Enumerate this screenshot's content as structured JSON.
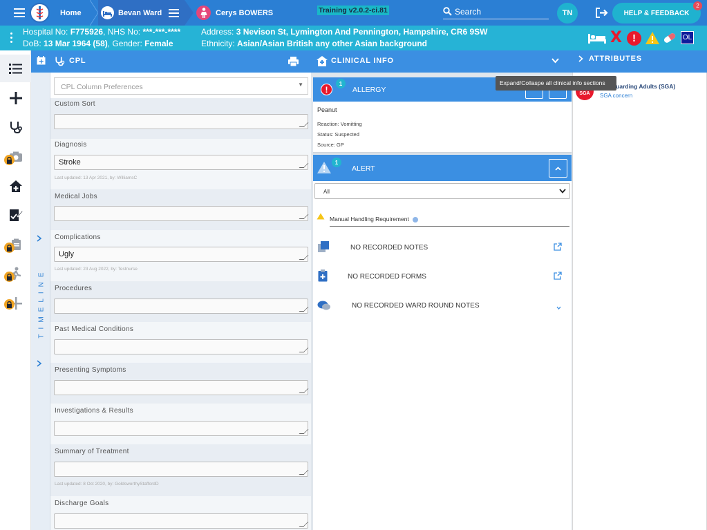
{
  "topbar": {
    "home_label": "Home",
    "ward_label": "Bevan Ward",
    "patient_label": "Cerys BOWERS",
    "training_label": "Training v2.0.2-ci.81",
    "search_label": "Search",
    "user_initials": "TN",
    "help_label": "HELP & FEEDBACK",
    "help_badge": "2"
  },
  "patient": {
    "hospital_no_label": "Hospital No:",
    "hospital_no": "F775926",
    "nhs_no_label": "NHS No:",
    "nhs_no": "***-***-****",
    "dob_label": "DoB:",
    "dob": "13 Mar 1964 (58)",
    "gender_label": "Gender:",
    "gender": "Female",
    "address_label": "Address:",
    "address": "3 Nevison St, Lymington And Pennington, Hampshire, CR6 9SW",
    "ethnicity_label": "Ethnicity:",
    "ethnicity": "Asian/Asian British any other Asian background",
    "ol_label": "OL"
  },
  "cpl": {
    "title": "CPL",
    "prefs_placeholder": "CPL Column Preferences",
    "timeline_label": "TIMELINE",
    "fields": [
      {
        "label": "Custom Sort",
        "value": "",
        "updated": ""
      },
      {
        "label": "Diagnosis",
        "value": "Stroke",
        "updated": "Last updated: 13 Apr 2021, by: WilliamsC"
      },
      {
        "label": "Medical Jobs",
        "value": "",
        "updated": ""
      },
      {
        "label": "Complications",
        "value": "Ugly",
        "updated": "Last updated: 23 Aug 2022, by: Testnurse"
      },
      {
        "label": "Procedures",
        "value": "",
        "updated": ""
      },
      {
        "label": "Past Medical Conditions",
        "value": "",
        "updated": ""
      },
      {
        "label": "Presenting Symptoms",
        "value": "",
        "updated": ""
      },
      {
        "label": "Investigations & Results",
        "value": "",
        "updated": ""
      },
      {
        "label": "Summary of Treatment",
        "value": "",
        "updated": "Last updated: 8 Oct 2020, by: GoldsworthyStaffordD"
      },
      {
        "label": "Discharge Goals",
        "value": "",
        "updated": ""
      }
    ]
  },
  "clinical": {
    "title": "CLINICAL INFO",
    "tooltip": "Expand/Collaspe all clinical info sections",
    "allergy": {
      "label": "ALLERGY",
      "count": "1",
      "name": "Peanut",
      "reaction": "Reaction: Vomitting",
      "status": "Status: Suspected",
      "source": "Source: GP"
    },
    "alert": {
      "label": "ALERT",
      "count": "1",
      "filter": "All",
      "item": "Manual Handling Requirement"
    },
    "notes_label": "NO RECORDED NOTES",
    "forms_label": "NO RECORDED FORMS",
    "ward_round_label": "NO RECORDED WARD ROUND NOTES"
  },
  "attributes": {
    "title": "ATTRIBUTES",
    "items": [
      {
        "badge": "SGA",
        "title": "Safeguarding Adults (SGA)",
        "visible_title": "uarding Adults (SGA)",
        "sub": "SGA concern"
      }
    ]
  },
  "colors": {
    "topbar": "#2b7fd4",
    "patient_bar": "#26b3d6",
    "header": "#3b8fe2",
    "lock": "#f0a321",
    "danger": "#e8192c",
    "warning": "#f5c518"
  }
}
